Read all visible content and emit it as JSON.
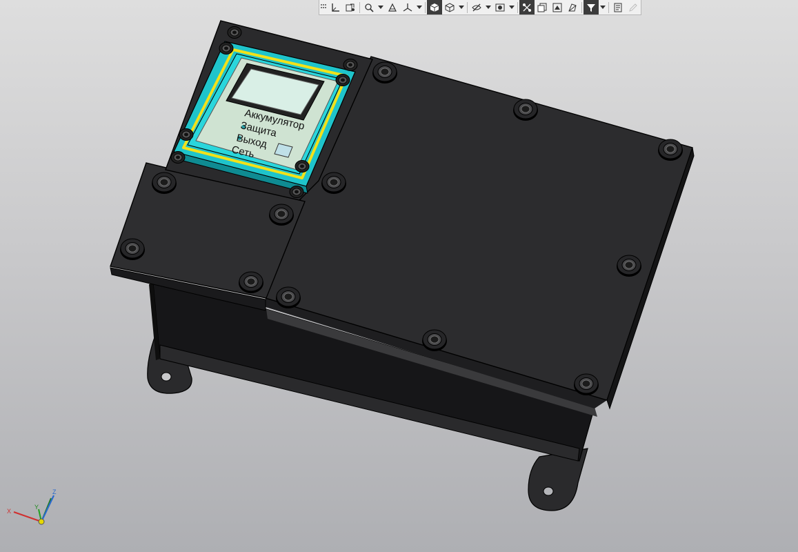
{
  "toolbar": {
    "buttons": [
      {
        "name": "grip",
        "icon": "grip-dots-icon"
      },
      {
        "name": "sketch-button",
        "icon": "orientation-axes-icon"
      },
      {
        "name": "local-cs-button",
        "icon": "local-coordinate-icon"
      },
      {
        "name": "zoom-button",
        "icon": "zoom-window-icon",
        "dropdown": true
      },
      {
        "name": "pan-button",
        "icon": "pan-icon"
      },
      {
        "name": "orientation-button",
        "icon": "orientation-icon",
        "dropdown": true
      },
      {
        "name": "shaded-button",
        "icon": "shaded-cube-icon",
        "active": true
      },
      {
        "name": "wireframe-button",
        "icon": "wireframe-cube-icon",
        "dropdown": true
      },
      {
        "name": "hide-button",
        "icon": "hidden-eye-icon",
        "dropdown": true
      },
      {
        "name": "view-mode-button",
        "icon": "view-eye-icon",
        "dropdown": true
      },
      {
        "name": "section-button",
        "icon": "section-icon",
        "active": true
      },
      {
        "name": "copy-view-button",
        "icon": "copy-view-icon"
      },
      {
        "name": "display-button",
        "icon": "display-icon"
      },
      {
        "name": "perspective-button",
        "icon": "perspective-icon"
      },
      {
        "name": "filter-button",
        "icon": "filter-icon",
        "active": true,
        "dropdown": true
      },
      {
        "name": "properties-button",
        "icon": "properties-icon"
      },
      {
        "name": "measure-button",
        "icon": "pencil-icon",
        "disabled": true
      }
    ]
  },
  "display": {
    "lines": [
      "Аккумулятор",
      "Защита",
      "Выход",
      "Сеть"
    ]
  },
  "triad": {
    "x_label": "X",
    "y_label": "Y",
    "z_label": "Z"
  },
  "colors": {
    "body": "#2c2c2e",
    "frame": "#2ad6dc",
    "gasket": "#f2e11a",
    "screen": "#cfe6d6"
  }
}
